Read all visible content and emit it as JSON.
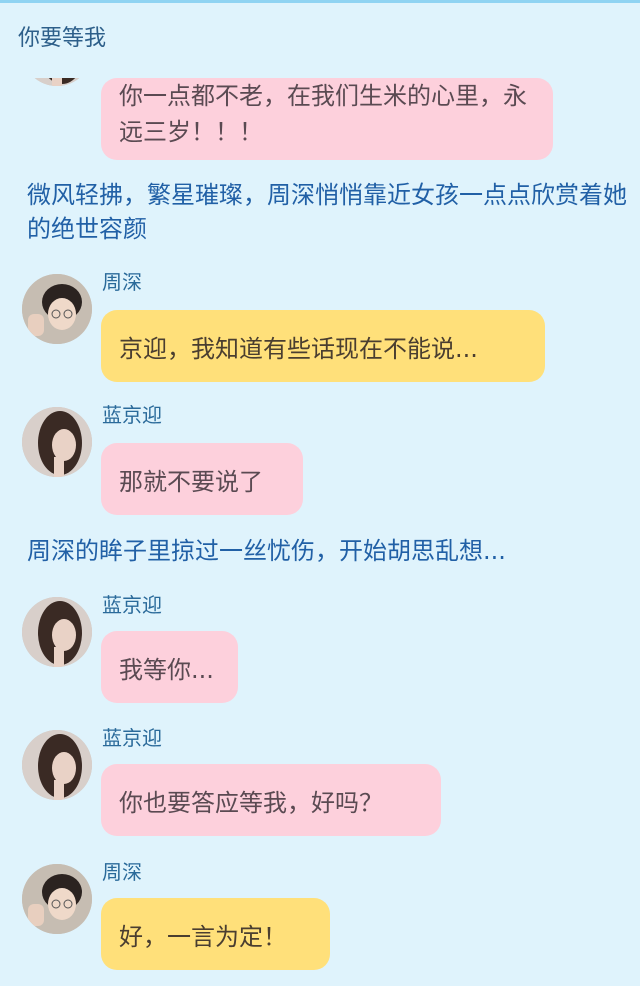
{
  "title": "你要等我",
  "messages": [
    {
      "type": "bubble",
      "speaker": "",
      "text": "你一点都不老，在我们生米的心里，永远三岁！！！",
      "color": "pink"
    },
    {
      "type": "narration",
      "text": "微风轻拂，繁星璀璨，周深悄悄靠近女孩一点点欣赏着她的绝世容颜"
    },
    {
      "type": "bubble",
      "speaker": "周深",
      "text": "京迎，我知道有些话现在不能说...",
      "color": "yellow"
    },
    {
      "type": "bubble",
      "speaker": "蓝京迎",
      "text": "那就不要说了",
      "color": "pink"
    },
    {
      "type": "narration",
      "text": "周深的眸子里掠过一丝忧伤，开始胡思乱想..."
    },
    {
      "type": "bubble",
      "speaker": "蓝京迎",
      "text": "我等你...",
      "color": "pink"
    },
    {
      "type": "bubble",
      "speaker": "蓝京迎",
      "text": "你也要答应等我，好吗？",
      "color": "pink"
    },
    {
      "type": "bubble",
      "speaker": "周深",
      "text": "好，一言为定！",
      "color": "yellow"
    }
  ],
  "colors": {
    "background": "#dff3fc",
    "pink_bubble": "#fdd0dc",
    "yellow_bubble": "#ffe07a",
    "speaker_name": "#2a6a9a",
    "narration": "#2160a6"
  },
  "icons": {
    "zhoushen_avatar": "avatar-man-photo",
    "lanjingying_avatar": "avatar-woman-photo"
  }
}
